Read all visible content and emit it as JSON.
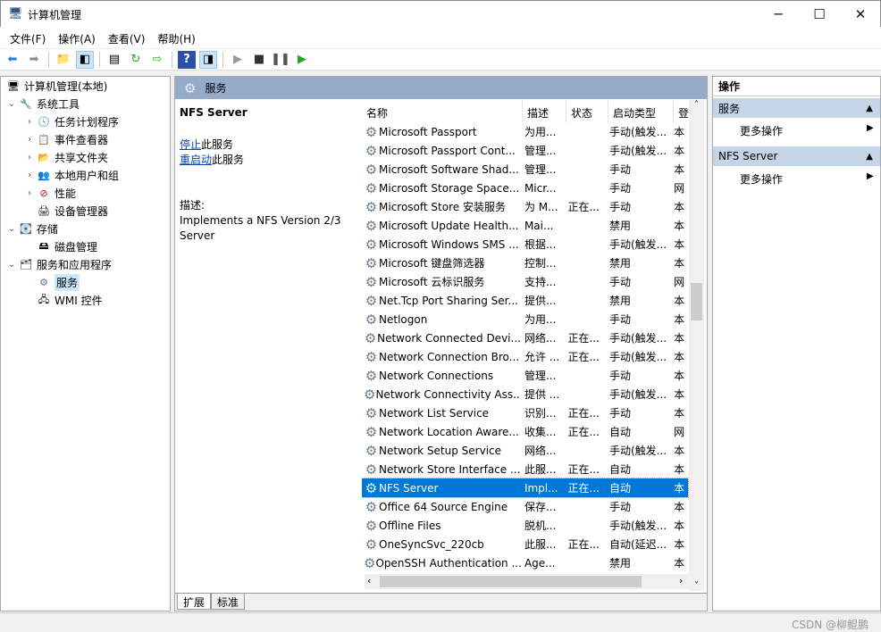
{
  "window": {
    "title": "计算机管理",
    "minimize": "─",
    "maximize": "☐",
    "close": "✕"
  },
  "menu": [
    "文件(F)",
    "操作(A)",
    "查看(V)",
    "帮助(H)"
  ],
  "tree": {
    "root": "计算机管理(本地)",
    "system_tools": "系统工具",
    "task_scheduler": "任务计划程序",
    "event_viewer": "事件查看器",
    "shared_folders": "共享文件夹",
    "local_users": "本地用户和组",
    "performance": "性能",
    "device_manager": "设备管理器",
    "storage": "存储",
    "disk_management": "磁盘管理",
    "services_apps": "服务和应用程序",
    "services": "服务",
    "wmi": "WMI 控件"
  },
  "main": {
    "header": "服务",
    "selected_name": "NFS Server",
    "stop_link": "停止",
    "stop_suffix": "此服务",
    "restart_link": "重启动",
    "restart_suffix": "此服务",
    "desc_label": "描述:",
    "desc_text": "Implements a NFS Version 2/3 Server"
  },
  "columns": [
    "名称",
    "描述",
    "状态",
    "启动类型",
    "登"
  ],
  "rows": [
    [
      "Microsoft Passport",
      "为用...",
      "",
      "手动(触发...",
      "本"
    ],
    [
      "Microsoft Passport Cont...",
      "管理...",
      "",
      "手动(触发...",
      "本"
    ],
    [
      "Microsoft Software Shad...",
      "管理...",
      "",
      "手动",
      "本"
    ],
    [
      "Microsoft Storage Space...",
      "Micr...",
      "",
      "手动",
      "网"
    ],
    [
      "Microsoft Store 安装服务",
      "为 M...",
      "正在...",
      "手动",
      "本"
    ],
    [
      "Microsoft Update Health...",
      "Mai...",
      "",
      "禁用",
      "本"
    ],
    [
      "Microsoft Windows SMS ...",
      "根据...",
      "",
      "手动(触发...",
      "本"
    ],
    [
      "Microsoft 键盘筛选器",
      "控制...",
      "",
      "禁用",
      "本"
    ],
    [
      "Microsoft 云标识服务",
      "支持...",
      "",
      "手动",
      "网"
    ],
    [
      "Net.Tcp Port Sharing Ser...",
      "提供...",
      "",
      "禁用",
      "本"
    ],
    [
      "Netlogon",
      "为用...",
      "",
      "手动",
      "本"
    ],
    [
      "Network Connected Devi...",
      "网络...",
      "正在...",
      "手动(触发...",
      "本"
    ],
    [
      "Network Connection Bro...",
      "允许 ...",
      "正在...",
      "手动(触发...",
      "本"
    ],
    [
      "Network Connections",
      "管理...",
      "",
      "手动",
      "本"
    ],
    [
      "Network Connectivity Ass...",
      "提供 ...",
      "",
      "手动(触发...",
      "本"
    ],
    [
      "Network List Service",
      "识别...",
      "正在...",
      "手动",
      "本"
    ],
    [
      "Network Location Aware...",
      "收集...",
      "正在...",
      "自动",
      "网"
    ],
    [
      "Network Setup Service",
      "网络...",
      "",
      "手动(触发...",
      "本"
    ],
    [
      "Network Store Interface ...",
      "此服...",
      "正在...",
      "自动",
      "本"
    ],
    [
      "NFS Server",
      "Impl...",
      "正在...",
      "自动",
      "本"
    ],
    [
      "Office 64 Source Engine",
      "保存...",
      "",
      "手动",
      "本"
    ],
    [
      "Offline Files",
      "脱机...",
      "",
      "手动(触发...",
      "本"
    ],
    [
      "OneSyncSvc_220cb",
      "此服...",
      "正在...",
      "自动(延迟...",
      "本"
    ],
    [
      "OpenSSH Authentication ...",
      "Age...",
      "",
      "禁用",
      "本"
    ]
  ],
  "selected_index": 19,
  "tabs": [
    "扩展",
    "标准"
  ],
  "actions": {
    "title": "操作",
    "section1": "服务",
    "more1": "更多操作",
    "section2": "NFS Server",
    "more2": "更多操作"
  },
  "watermark": "CSDN @柳鲲鹏"
}
